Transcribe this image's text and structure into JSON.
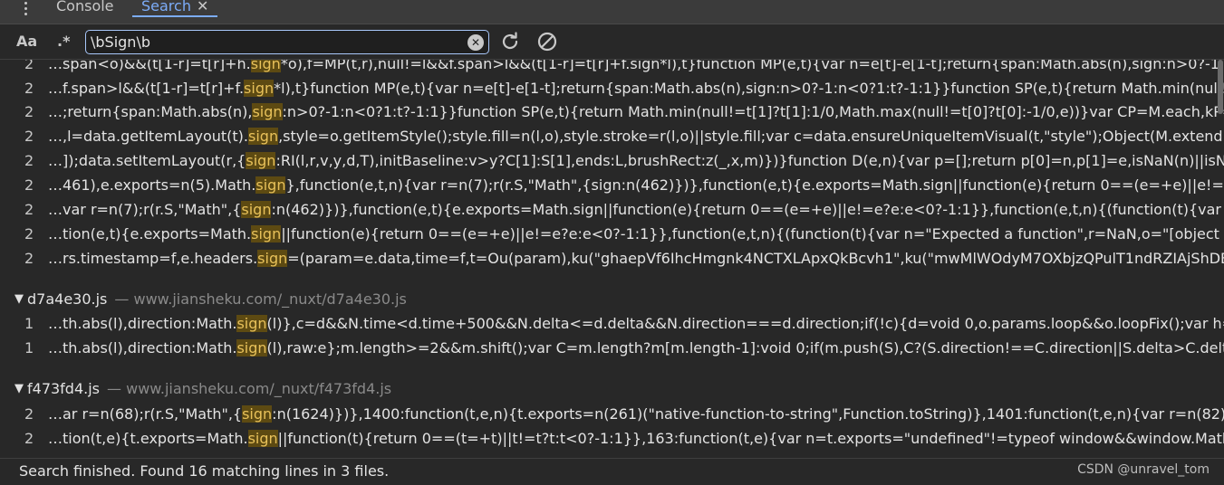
{
  "tabs": {
    "console": "Console",
    "search": "Search"
  },
  "toolbar": {
    "match_case": "Aa",
    "regex": ".*",
    "query": "\\bSign\\b"
  },
  "groups": [
    {
      "rows": [
        {
          "line": "2",
          "pre": "…span<o)&&(t[1-r]=t[r]+h.",
          "match": "sign",
          "post": "*o),f=MP(t,r),null!=l&&f.span>l&&(t[1-r]=t[r]+f.sign*l),t}function MP(e,t){var n=e[t]-e[1-t];return{span:Math.abs(n),sign:n>0?-1:n<0?"
        },
        {
          "line": "2",
          "pre": "…f.span>l&&(t[1-r]=t[r]+f.",
          "match": "sign",
          "post": "*l),t}function MP(e,t){var n=e[t]-e[1-t];return{span:Math.abs(n),sign:n>0?-1:n<0?1:t?-1:1}}function SP(e,t){return Math.min(null!=t[1]?t"
        },
        {
          "line": "2",
          "pre": "…;return{span:Math.abs(n),",
          "match": "sign",
          "post": ":n>0?-1:n<0?1:t?-1:1}}function SP(e,t){return Math.min(null!=t[1]?t[1]:1/0,Math.max(null!=t[0]?t[0]:-1/0,e))}var CP=M.each,kP=Math.r"
        },
        {
          "line": "2",
          "pre": "…,l=data.getItemLayout(t).",
          "match": "sign",
          "post": ",style=o.getItemStyle();style.fill=n(l,o),style.stroke=r(l,o)||style.fill;var c=data.ensureUniqueItemVisual(t,\"style\");Object(M.extend)(c,s"
        },
        {
          "line": "2",
          "pre": "…]);data.setItemLayout(r,{",
          "match": "sign",
          "post": ":RI(l,r,v,y,d,T),initBaseline:v>y?C[1]:S[1],ends:L,brushRect:z(_,x,m)})}function D(e,n){var p=[];return p[0]=n,p[1]=e,isNaN(n)||isNaN(e)?["
        },
        {
          "line": "2",
          "pre": "…461),e.exports=n(5).Math.",
          "match": "sign",
          "post": "},function(e,t,n){var r=n(7);r(r.S,\"Math\",{sign:n(462)})},function(e,t){e.exports=Math.sign||function(e){return 0==(e=+e)||e!=e?e:e<0?-1"
        },
        {
          "line": "2",
          "pre": "…var r=n(7);r(r.S,\"Math\",{",
          "match": "sign",
          "post": ":n(462)})},function(e,t){e.exports=Math.sign||function(e){return 0==(e=+e)||e!=e?e:e<0?-1:1}},function(e,t,n){(function(t){var n=\"Expecte"
        },
        {
          "line": "2",
          "pre": "…tion(e,t){e.exports=Math.",
          "match": "sign",
          "post": "||function(e){return 0==(e=+e)||e!=e?e:e<0?-1:1}},function(e,t,n){(function(t){var n=\"Expected a function\",r=NaN,o=\"[object Symbol]\""
        },
        {
          "line": "2",
          "pre": "…rs.timestamp=f,e.headers.",
          "match": "sign",
          "post": "=(param=e.data,time=f,t=Ou(param),ku(\"ghaepVf6IhcHmgnk4NCTXLApxQkBcvh1\",ku(\"mwMlWOdyM7OXbjzQPulT1ndRZIAjShDB\""
        }
      ]
    },
    {
      "file": "d7a4e30.js",
      "path": "www.jiansheku.com/_nuxt/d7a4e30.js",
      "rows": [
        {
          "line": "1",
          "pre": "…th.abs(l),direction:Math.",
          "match": "sign",
          "post": "(l)},c=d&&N.time<d.time+500&&N.delta<=d.delta&&N.direction===d.direction;if(!c){d=void 0,o.params.loop&&o.loopFix();var h=o.ge"
        },
        {
          "line": "1",
          "pre": "…th.abs(l),direction:Math.",
          "match": "sign",
          "post": "(l),raw:e};m.length>=2&&m.shift();var C=m.length?m[m.length-1]:void 0;if(m.push(S),C?(S.direction!==C.direction||S.delta>C.delta||S.t"
        }
      ]
    },
    {
      "file": "f473fd4.js",
      "path": "www.jiansheku.com/_nuxt/f473fd4.js",
      "rows": [
        {
          "line": "2",
          "pre": "…ar r=n(68);r(r.S,\"Math\",{",
          "match": "sign",
          "post": ":n(1624)})},1400:function(t,e,n){t.exports=n(261)(\"native-function-to-string\",Function.toString)},1401:function(t,e,n){var r=n(82),o=n(1"
        },
        {
          "line": "2",
          "pre": "…tion(t,e){t.exports=Math.",
          "match": "sign",
          "post": "||function(t){return 0==(t=+t)||t!=t?t:t<0?-1:1}},163:function(t,e){var n=t.exports=\"undefined\"!=typeof window&&window.Math==Mat"
        }
      ]
    }
  ],
  "status": {
    "text": "Search finished.  Found 16 matching lines in 3 files.",
    "watermark": "CSDN @unravel_tom"
  },
  "icons": {
    "more": "kebab-menu-icon",
    "close": "close-icon",
    "clear": "clear-icon",
    "refresh": "refresh-icon",
    "cancel": "cancel-icon",
    "expand": "triangle-down-icon"
  },
  "colors": {
    "accent": "#7cacf8",
    "highlight_bg": "#5d4a12",
    "highlight_fg": "#e8c15a"
  }
}
